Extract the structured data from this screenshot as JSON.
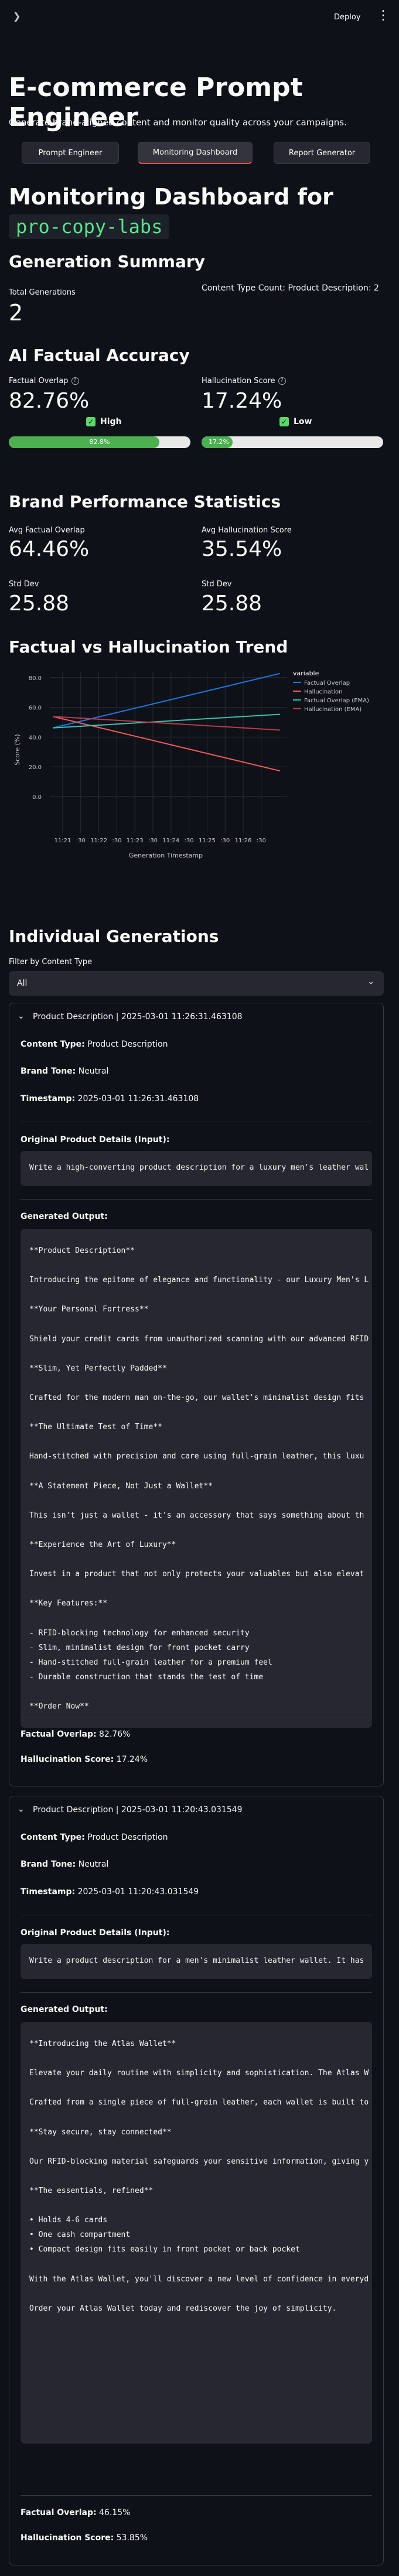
{
  "header": {
    "deploy_label": "Deploy",
    "menu_icon": "kebab-icon"
  },
  "app": {
    "title": "E-commerce Prompt Engineer",
    "subtitle": "Generate brand-aligned content and monitor quality across your campaigns."
  },
  "tabs": [
    {
      "label": "Prompt Engineer"
    },
    {
      "label": "Monitoring Dashboard"
    },
    {
      "label": "Report Generator"
    }
  ],
  "monitoring": {
    "title_prefix": "Monitoring Dashboard for",
    "app_name": "pro-copy-labs"
  },
  "generation_summary": {
    "heading": "Generation Summary",
    "total_label": "Total Generations",
    "total_value": "2",
    "content_type_label": "Content Type Count: Product Description: 2"
  },
  "ai_accuracy": {
    "heading": "AI Factual Accuracy",
    "factual_label": "Factual Overlap",
    "factual_value": "82.76%",
    "factual_level": "High",
    "factual_bar_text": "82.8%",
    "factual_fraction": 0.8276,
    "halluc_label": "Hallucination Score",
    "halluc_value": "17.24%",
    "halluc_level": "Low",
    "halluc_bar_text": "17.2%",
    "halluc_fraction": 0.1724,
    "colors": {
      "high": "#5cd86a",
      "low": "#5cd86a",
      "factual_bar": "#4caf50",
      "halluc_bar": "#4caf50"
    }
  },
  "brand_performance": {
    "heading": "Brand Performance Statistics",
    "avg_factual_label": "Avg Factual Overlap",
    "avg_factual_value": "64.46%",
    "avg_halluc_label": "Avg Hallucination Score",
    "avg_halluc_value": "35.54%",
    "std_label_1": "Std Dev",
    "std_value_1": "25.88",
    "std_label_2": "Std Dev",
    "std_value_2": "25.88"
  },
  "trend": {
    "heading": "Factual vs Hallucination Trend"
  },
  "chart_data": {
    "type": "line",
    "xlabel": "Generation Timestamp",
    "ylabel": "Score (%)",
    "ylim": [
      0,
      90
    ],
    "yticks": [
      "0.0",
      "20.0",
      "40.0",
      "60.0",
      "80.0"
    ],
    "xticks": [
      "11:21",
      ":30",
      "11:22",
      ":30",
      "11:23",
      ":30",
      "11:24",
      ":30",
      "11:25",
      ":30",
      "11:26",
      ":30"
    ],
    "x": [
      "11:20:43",
      "11:26:31"
    ],
    "legend_title": "variable",
    "legend_position": "top-right",
    "series": [
      {
        "name": "Factual Overlap",
        "values": [
          46.15,
          82.76
        ],
        "color": "#1f77e8"
      },
      {
        "name": "Hallucination",
        "values": [
          53.85,
          17.24
        ],
        "color": "#f25a5a"
      },
      {
        "name": "Factual Overlap (EMA)",
        "values": [
          46.15,
          55.3
        ],
        "color": "#3cbfb0"
      },
      {
        "name": "Hallucination (EMA)",
        "values": [
          53.85,
          44.7
        ],
        "color": "#b63b4a"
      }
    ]
  },
  "individual": {
    "heading": "Individual Generations",
    "filter_label": "Filter by Content Type",
    "filter_value": "All"
  },
  "generations": [
    {
      "header": "Product Description | 2025-03-01 11:26:31.463108",
      "content_type_label": "Content Type:",
      "content_type": "Product Description",
      "brand_tone_label": "Brand Tone:",
      "brand_tone": "Neutral",
      "timestamp_label": "Timestamp:",
      "timestamp": "2025-03-01 11:26:31.463108",
      "input_label": "Original Product Details (Input):",
      "input": "Write a high-converting product description for a luxury men's leather wal",
      "output_label": "Generated Output:",
      "output_lines": [
        "**Product Description**",
        "",
        "Introducing the epitome of elegance and functionality - our Luxury Men's L",
        "",
        "**Your Personal Fortress**",
        "",
        "Shield your credit cards from unauthorized scanning with our advanced RFID",
        "",
        "**Slim, Yet Perfectly Padded**",
        "",
        "Crafted for the modern man on-the-go, our wallet's minimalist design fits",
        "",
        "**The Ultimate Test of Time**",
        "",
        "Hand-stitched with precision and care using full-grain leather, this luxu",
        "",
        "**A Statement Piece, Not Just a Wallet**",
        "",
        "This isn't just a wallet - it's an accessory that says something about th",
        "",
        "**Experience the Art of Luxury**",
        "",
        "Invest in a product that not only protects your valuables but also elevat",
        "",
        "**Key Features:**",
        "",
        "- RFID-blocking technology for enhanced security",
        "- Slim, minimalist design for front pocket carry",
        "- Hand-stitched full-grain leather for a premium feel",
        "- Durable construction that stands the test of time",
        "",
        "**Order Now**"
      ],
      "factual_label": "Factual Overlap:",
      "factual": "82.76%",
      "halluc_label": "Hallucination Score:",
      "halluc": "17.24%"
    },
    {
      "header": "Product Description | 2025-03-01 11:20:43.031549",
      "content_type_label": "Content Type:",
      "content_type": "Product Description",
      "brand_tone_label": "Brand Tone:",
      "brand_tone": "Neutral",
      "timestamp_label": "Timestamp:",
      "timestamp": "2025-03-01 11:20:43.031549",
      "input_label": "Original Product Details (Input):",
      "input": "Write a product description for a men's minimalist leather wallet. It has",
      "output_label": "Generated Output:",
      "output_lines": [
        "**Introducing the Atlas Wallet**",
        "",
        "Elevate your daily routine with simplicity and sophistication. The Atlas W",
        "",
        "Crafted from a single piece of full-grain leather, each wallet is built to",
        "",
        "**Stay secure, stay connected**",
        "",
        "Our RFID-blocking material safeguards your sensitive information, giving y",
        "",
        "**The essentials, refined**",
        "",
        "• Holds 4-6 cards",
        "• One cash compartment",
        "• Compact design fits easily in front pocket or back pocket",
        "",
        "With the Atlas Wallet, you'll discover a new level of confidence in everyd",
        "",
        "Order your Atlas Wallet today and rediscover the joy of simplicity."
      ],
      "factual_label": "Factual Overlap:",
      "factual": "46.15%",
      "halluc_label": "Hallucination Score:",
      "halluc": "53.85%"
    }
  ]
}
